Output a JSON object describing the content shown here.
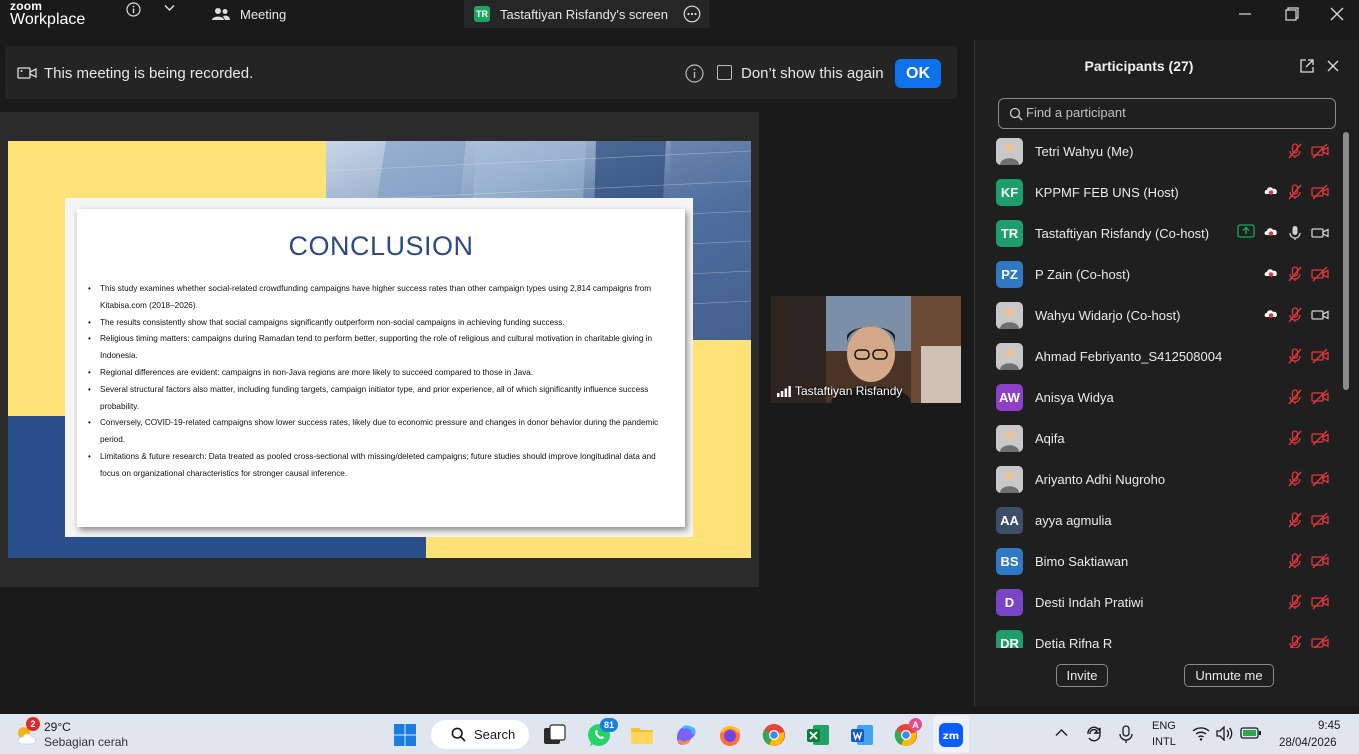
{
  "titlebar": {
    "logo_top": "zoom",
    "logo_bottom": "Workplace",
    "tab_meeting": "Meeting",
    "tab_screen_badge": "TR",
    "tab_screen": "Tastaftiyan Risfandy's screen"
  },
  "banner": {
    "message": "This meeting is being recorded.",
    "checkbox_label": "Don’t show this again",
    "ok_label": "OK"
  },
  "slide": {
    "title": "CONCLUSION",
    "bullets": [
      "This study examines whether social-related crowdfunding campaigns have higher success rates than other campaign types using 2,814 campaigns from Kitabisa.com (2018–2026).",
      "The results consistently show that social campaigns significantly outperform non-social campaigns in achieving funding success.",
      "Religious timing matters: campaigns during Ramadan tend to perform better, supporting the role of religious and cultural motivation in charitable giving in Indonesia.",
      "Regional differences are evident: campaigns in non-Java regions are more likely to succeed compared to those in Java.",
      "Several structural factors also matter, including funding targets, campaign initiator type, and prior experience, all of which significantly influence success probability.",
      "Conversely, COVID-19-related campaigns show lower success rates, likely due to economic pressure and changes in donor behavior during the pandemic period.",
      "Limitations & future research: Data treated as pooled cross-sectional with missing/deleted campaigns; future studies should improve longitudinal data and focus on organizational characteristics for stronger causal inference."
    ]
  },
  "video_tile": {
    "name": "Tastaftiyan Risfandy"
  },
  "participants": {
    "title": "Participants (27)",
    "search_placeholder": "Find a participant",
    "list": [
      {
        "name": "Tetri Wahyu (Me)",
        "initials": "",
        "color": "#d9d9d9",
        "photo": true,
        "mic": "muted",
        "video": "off",
        "rec": false,
        "share": false
      },
      {
        "name": "KPPMF FEB UNS (Host)",
        "initials": "KF",
        "color": "#1e9e6a",
        "mic": "muted",
        "video": "off",
        "rec": true,
        "share": false
      },
      {
        "name": "Tastaftiyan Risfandy (Co-host)",
        "initials": "TR",
        "color": "#1e9e6a",
        "mic": "on",
        "video": "on",
        "rec": true,
        "share": true
      },
      {
        "name": "P Zain (Co-host)",
        "initials": "PZ",
        "color": "#2f78c4",
        "mic": "muted",
        "video": "off",
        "rec": true,
        "share": false
      },
      {
        "name": "Wahyu Widarjo (Co-host)",
        "initials": "",
        "color": "#c83a3a",
        "photo": true,
        "mic": "muted",
        "video": "on",
        "rec": true,
        "share": false
      },
      {
        "name": "Ahmad Febriyanto_S412508004",
        "initials": "",
        "color": "#8a8a8a",
        "photo": true,
        "mic": "muted",
        "video": "off",
        "rec": false,
        "share": false
      },
      {
        "name": "Anisya Widya",
        "initials": "AW",
        "color": "#8e3fc8",
        "mic": "muted",
        "video": "off",
        "rec": false,
        "share": false
      },
      {
        "name": "Aqifa",
        "initials": "",
        "color": "#cfcfcf",
        "photo": true,
        "mic": "muted",
        "video": "off",
        "rec": false,
        "share": false
      },
      {
        "name": "Ariyanto Adhi Nugroho",
        "initials": "",
        "color": "#e8e8e8",
        "photo": true,
        "mic": "muted",
        "video": "off",
        "rec": false,
        "share": false
      },
      {
        "name": "ayya agmulia",
        "initials": "AA",
        "color": "#3d4f66",
        "mic": "muted",
        "video": "off",
        "rec": false,
        "share": false
      },
      {
        "name": "Bimo Saktiawan",
        "initials": "BS",
        "color": "#2f78c4",
        "mic": "muted",
        "video": "off",
        "rec": false,
        "share": false
      },
      {
        "name": "Desti Indah Pratiwi",
        "initials": "D",
        "color": "#7a45c4",
        "mic": "muted",
        "video": "off",
        "rec": false,
        "share": false
      },
      {
        "name": "Detia Rifna R",
        "initials": "DR",
        "color": "#1e9e6a",
        "mic": "muted",
        "video": "off",
        "rec": false,
        "share": false
      }
    ],
    "invite_label": "Invite",
    "unmute_label": "Unmute me"
  },
  "taskbar": {
    "weather_badge": "2",
    "temperature": "29°C",
    "weather_desc": "Sebagian cerah",
    "search_label": "Search",
    "whatsapp_badge": "81",
    "chrome_badge": "A",
    "lang_top": "ENG",
    "lang_bottom": "INTL",
    "time": "9:45",
    "date": "28/04/2026"
  },
  "colors": {
    "accent": "#0e72ed",
    "slide_title": "#2d4a86",
    "slide_yellow": "#fde277",
    "slide_blue": "#2b4f8a",
    "muted_icon": "#e0393e"
  }
}
